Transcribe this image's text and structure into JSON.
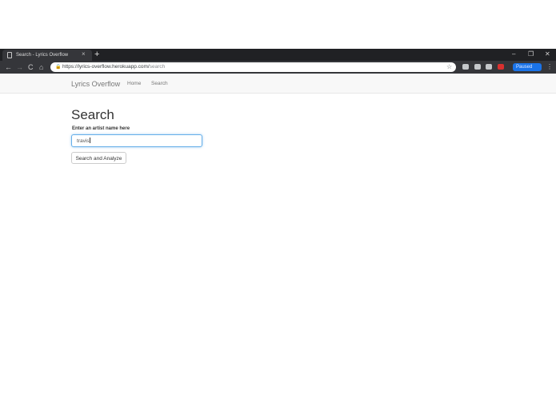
{
  "browser": {
    "tab_title": "Search - Lyrics Overflow",
    "tab_close": "×",
    "new_tab": "+",
    "url_host": "https://lyrics-overflow.herokuapp.com/",
    "url_path": "search",
    "profile_label": "Paused",
    "window_controls": {
      "minimize": "–",
      "maximize": "❐",
      "close": "✕"
    },
    "nav": {
      "back": "←",
      "forward": "→",
      "reload": "C",
      "home": "⌂"
    },
    "star": "☆",
    "menu": "⋮"
  },
  "navbar": {
    "brand": "Lyrics Overflow",
    "links": [
      "Home",
      "Search"
    ]
  },
  "main": {
    "title": "Search",
    "label": "Enter an artist name here",
    "input_value": "travis",
    "button_label": "Search and Analyze"
  },
  "colors": {
    "chrome_dark": "#202124",
    "chrome_toolbar": "#35363a",
    "focus_border": "#66afe9",
    "navbar_bg": "#f8f8f8"
  }
}
